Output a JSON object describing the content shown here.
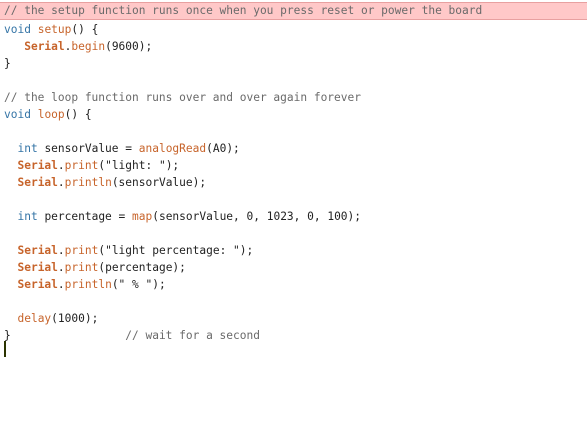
{
  "editor": {
    "lines": [
      {
        "segments": [
          {
            "cls": "comment",
            "text": "// the setup function runs once when you press reset or power the board"
          }
        ]
      },
      {
        "segments": [
          {
            "cls": "kw-type",
            "text": "void"
          },
          {
            "cls": "plain",
            "text": " "
          },
          {
            "cls": "kw-func",
            "text": "setup"
          },
          {
            "cls": "plain",
            "text": "() {"
          }
        ]
      },
      {
        "segments": [
          {
            "cls": "plain",
            "text": "   "
          },
          {
            "cls": "kw-class",
            "text": "Serial"
          },
          {
            "cls": "plain",
            "text": "."
          },
          {
            "cls": "kw-func",
            "text": "begin"
          },
          {
            "cls": "plain",
            "text": "(9600);"
          }
        ]
      },
      {
        "segments": [
          {
            "cls": "plain",
            "text": "}"
          }
        ]
      },
      {
        "segments": []
      },
      {
        "segments": [
          {
            "cls": "comment",
            "text": "// the loop function runs over and over again forever"
          }
        ]
      },
      {
        "segments": [
          {
            "cls": "kw-type",
            "text": "void"
          },
          {
            "cls": "plain",
            "text": " "
          },
          {
            "cls": "kw-func",
            "text": "loop"
          },
          {
            "cls": "plain",
            "text": "() {"
          }
        ]
      },
      {
        "segments": []
      },
      {
        "segments": [
          {
            "cls": "plain",
            "text": "  "
          },
          {
            "cls": "kw-type",
            "text": "int"
          },
          {
            "cls": "plain",
            "text": " sensorValue = "
          },
          {
            "cls": "kw-func",
            "text": "analogRead"
          },
          {
            "cls": "plain",
            "text": "(A0);"
          }
        ]
      },
      {
        "segments": [
          {
            "cls": "plain",
            "text": "  "
          },
          {
            "cls": "kw-class",
            "text": "Serial"
          },
          {
            "cls": "plain",
            "text": "."
          },
          {
            "cls": "kw-func",
            "text": "print"
          },
          {
            "cls": "plain",
            "text": "(\"light: \");"
          }
        ]
      },
      {
        "segments": [
          {
            "cls": "plain",
            "text": "  "
          },
          {
            "cls": "kw-class",
            "text": "Serial"
          },
          {
            "cls": "plain",
            "text": "."
          },
          {
            "cls": "kw-func",
            "text": "println"
          },
          {
            "cls": "plain",
            "text": "(sensorValue);"
          }
        ]
      },
      {
        "segments": []
      },
      {
        "segments": [
          {
            "cls": "plain",
            "text": "  "
          },
          {
            "cls": "kw-type",
            "text": "int"
          },
          {
            "cls": "plain",
            "text": " percentage = "
          },
          {
            "cls": "kw-func",
            "text": "map"
          },
          {
            "cls": "plain",
            "text": "(sensorValue, 0, 1023, 0, 100);"
          }
        ]
      },
      {
        "segments": []
      },
      {
        "segments": [
          {
            "cls": "plain",
            "text": "  "
          },
          {
            "cls": "kw-class",
            "text": "Serial"
          },
          {
            "cls": "plain",
            "text": "."
          },
          {
            "cls": "kw-func",
            "text": "print"
          },
          {
            "cls": "plain",
            "text": "(\"light percentage: \");"
          }
        ]
      },
      {
        "segments": [
          {
            "cls": "plain",
            "text": "  "
          },
          {
            "cls": "kw-class",
            "text": "Serial"
          },
          {
            "cls": "plain",
            "text": "."
          },
          {
            "cls": "kw-func",
            "text": "print"
          },
          {
            "cls": "plain",
            "text": "(percentage);"
          }
        ]
      },
      {
        "segments": [
          {
            "cls": "plain",
            "text": "  "
          },
          {
            "cls": "kw-class",
            "text": "Serial"
          },
          {
            "cls": "plain",
            "text": "."
          },
          {
            "cls": "kw-func",
            "text": "println"
          },
          {
            "cls": "plain",
            "text": "(\" % \");"
          }
        ]
      },
      {
        "segments": []
      },
      {
        "segments": [
          {
            "cls": "plain",
            "text": "  "
          },
          {
            "cls": "kw-func",
            "text": "delay"
          },
          {
            "cls": "plain",
            "text": "(1000);"
          }
        ]
      },
      {
        "segments": [
          {
            "cls": "plain",
            "text": "}"
          },
          {
            "cls": "plain",
            "text": "                 "
          },
          {
            "cls": "comment",
            "text": "// wait for a second"
          }
        ]
      }
    ]
  },
  "colors": {
    "comment": "#6a6a6a",
    "type_keyword": "#3474a6",
    "function_keyword": "#c7642b",
    "highlight_line": "#ffc8c8"
  }
}
